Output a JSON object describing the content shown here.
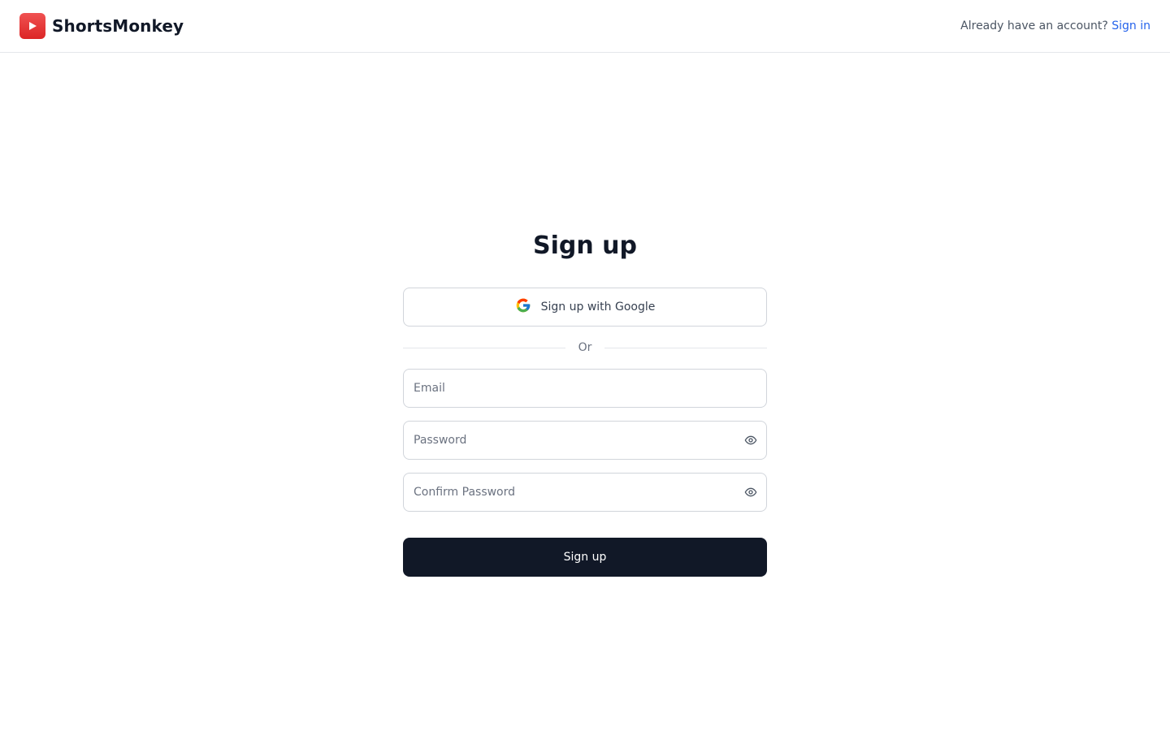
{
  "header": {
    "brand_name": "ShortsMonkey",
    "account_prompt": "Already have an account?",
    "sign_in_link": "Sign in",
    "logo_icon": "play-icon",
    "brand_color": "#dc2626",
    "link_color": "#2563eb"
  },
  "form": {
    "title": "Sign up",
    "google_button_label": "Sign up with Google",
    "google_icon": "google-icon",
    "divider_text": "Or",
    "email": {
      "placeholder": "Email",
      "value": ""
    },
    "password": {
      "placeholder": "Password",
      "value": "",
      "toggle_icon": "eye-icon"
    },
    "confirm_password": {
      "placeholder": "Confirm Password",
      "value": "",
      "toggle_icon": "eye-icon"
    },
    "submit_label": "Sign up",
    "submit_color": "#111827"
  }
}
